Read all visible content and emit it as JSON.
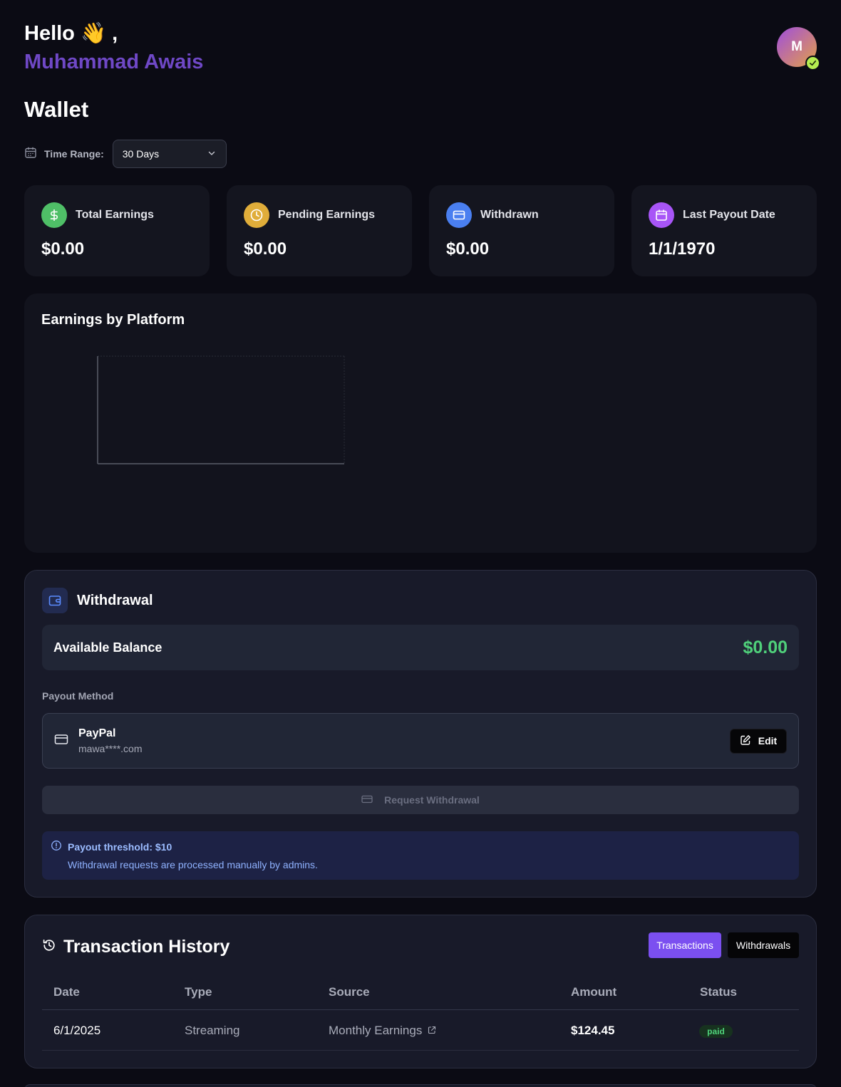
{
  "header": {
    "greeting": "Hello 👋 ,",
    "username": "Muhammad Awais",
    "avatar_initial": "M",
    "verified_icon": "check-icon"
  },
  "page": {
    "title": "Wallet"
  },
  "time_range": {
    "label": "Time Range:",
    "selected": "30 Days"
  },
  "stats": [
    {
      "label": "Total Earnings",
      "value": "$0.00",
      "icon": "dollar-icon",
      "color": "#4fbf67"
    },
    {
      "label": "Pending Earnings",
      "value": "$0.00",
      "icon": "clock-icon",
      "color": "#e0ad3a"
    },
    {
      "label": "Withdrawn",
      "value": "$0.00",
      "icon": "credit-card-icon",
      "color": "#4a7ff0"
    },
    {
      "label": "Last Payout Date",
      "value": "1/1/1970",
      "icon": "calendar-icon",
      "color": "#a855f7"
    }
  ],
  "platform_chart": {
    "title": "Earnings by Platform"
  },
  "chart_data": {
    "type": "bar",
    "categories": [],
    "values": [],
    "title": "Earnings by Platform"
  },
  "withdrawal": {
    "title": "Withdrawal",
    "balance_label": "Available Balance",
    "balance_value": "$0.00",
    "payout_method_label": "Payout Method",
    "payout_name": "PayPal",
    "payout_email": "mawa****.com",
    "edit_label": "Edit",
    "request_label": "Request Withdrawal",
    "info_title": "Payout threshold: $10",
    "info_text": "Withdrawal requests are processed manually by admins."
  },
  "history": {
    "title": "Transaction History",
    "tabs": [
      "Transactions",
      "Withdrawals"
    ],
    "columns": [
      "Date",
      "Type",
      "Source",
      "Amount",
      "Status"
    ],
    "rows": [
      {
        "date": "6/1/2025",
        "type": "Streaming",
        "source": "Monthly Earnings",
        "amount": "$124.45",
        "status": "paid"
      }
    ]
  },
  "colors": {
    "accent": "#7b4ff0",
    "username": "#6f48c6",
    "balance": "#4fcf7a"
  }
}
